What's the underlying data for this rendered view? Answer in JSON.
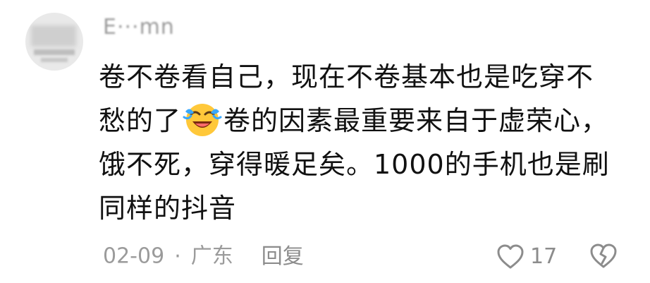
{
  "comment": {
    "username": "E···mn",
    "text_part1": "卷不卷看自己，现在不卷基本也是吃穿不愁的了",
    "emoji": "crying-laughing-emoji",
    "text_part2": "卷的因素最重要来自于虚荣心，饿不死，穿得暖足矣。1000的手机也是刷同样的抖音",
    "date": "02-09",
    "separator": "·",
    "location": "广东",
    "reply_label": "回复",
    "like_count": "17"
  },
  "colors": {
    "text": "#111111",
    "meta": "#9b9b9b",
    "emoji_face": "#ffc83a",
    "emoji_tears": "#38a8ff"
  }
}
